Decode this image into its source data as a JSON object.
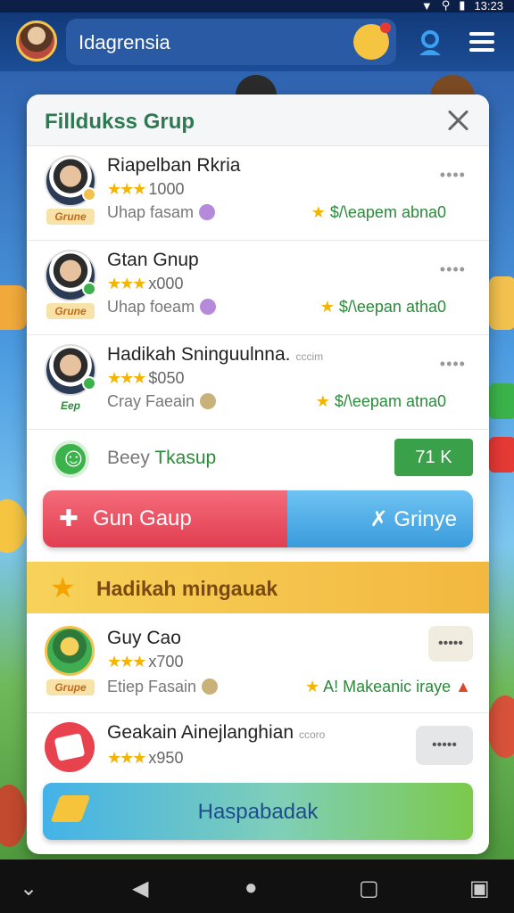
{
  "status_bar": {
    "time": "13:23"
  },
  "top_bar": {
    "search_value": "Idagrensia"
  },
  "modal": {
    "title": "Filldukss Grup",
    "members": [
      {
        "name": "Riapelban Rkria",
        "rank": "Grune",
        "stars": "★★★",
        "rating": "1000",
        "sub": "Uhap fasam",
        "reward": "$/\\eapem abna0",
        "extra": ""
      },
      {
        "name": "Gtan Gnup",
        "rank": "Grune",
        "stars": "★★★",
        "rating": "x000",
        "sub": "Uhap foeam",
        "reward": "$/\\eepan atha0",
        "extra": ""
      },
      {
        "name": "Hadikah Sninguulnna.",
        "rank": "Eep",
        "stars": "★★★",
        "rating": "$050",
        "sub": "Cray Faeain",
        "reward": "$/\\eepam atna0",
        "extra": "cccim"
      }
    ],
    "invite": {
      "label_prefix": "Beey",
      "label_accent": "Tkasup",
      "count": "71 K"
    },
    "dual_button": {
      "left_label": "Gun Gaup",
      "right_label": "Grinye"
    },
    "gift_banner": {
      "label": "Hadikah mingauak"
    },
    "gift_members": [
      {
        "name": "Guy Cao",
        "rank": "Grupe",
        "stars": "★★★",
        "rating": "x700",
        "sub": "Etiep Fasain",
        "reward": "A! Makeanic iraye",
        "bubble": "•••••"
      },
      {
        "name": "Geakain Ainejlanghian",
        "stars": "★★★",
        "rating": "x950",
        "extra": "ccoro",
        "bubble": "•••••"
      }
    ],
    "primary_button": {
      "label": "Haspabadak"
    }
  },
  "colors": {
    "title_green": "#2d7a52",
    "reward_green": "#2a8a3a",
    "badge_green": "#3aa14a"
  }
}
